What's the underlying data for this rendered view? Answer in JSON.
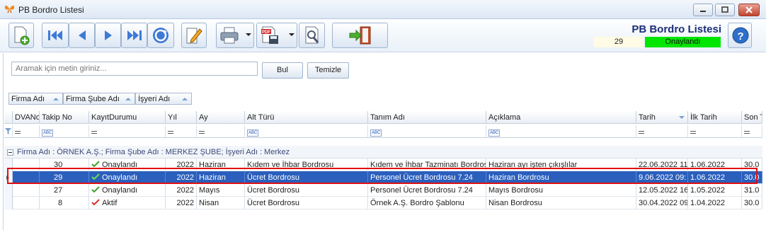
{
  "window": {
    "title": "PB Bordro Listesi"
  },
  "toolbar": {
    "buttons": [
      {
        "icon": "new-document-icon"
      },
      {
        "icon": "first-record-icon"
      },
      {
        "icon": "previous-record-icon"
      },
      {
        "icon": "next-record-icon"
      },
      {
        "icon": "last-record-icon"
      },
      {
        "icon": "refresh-icon"
      },
      {
        "icon": "edit-icon"
      },
      {
        "icon": "print-icon"
      },
      {
        "icon": "pdf-export-icon"
      },
      {
        "icon": "search-settings-icon"
      },
      {
        "icon": "exit-icon"
      }
    ]
  },
  "header": {
    "title": "PB Bordro Listesi",
    "record_no": "29",
    "status": "Onaylandı",
    "status_color": "#00e600"
  },
  "search": {
    "placeholder": "Aramak için metin giriniz...",
    "find_label": "Bul",
    "clear_label": "Temizle"
  },
  "grouping": [
    "Firma Adı",
    "Firma Şube Adı",
    "İşyeri Adı"
  ],
  "columns": [
    "DVANo",
    "Takip No",
    "KayıtDurumu",
    "Yıl",
    "Ay",
    "Alt Türü",
    "Tanım Adı",
    "Açıklama",
    "Tarih",
    "İlk Tarih",
    "Son T"
  ],
  "group_row": "Firma Adı : ÖRNEK A.Ş.;  Firma Şube Adı : MERKEZ ŞUBE;  İşyeri Adı : Merkez",
  "rows": [
    {
      "takip": "30",
      "durum": "Onaylandı",
      "yil": "2022",
      "ay": "Haziran",
      "alt": "Kıdem ve İhbar Bordrosu",
      "tanim": "Kıdem ve İhbar Tazminatı Bordros",
      "aciklama": "Haziran ayı işten çıkışlılar",
      "tarih": "22.06.2022 11",
      "ilk": "1.06.2022",
      "son": "30.0"
    },
    {
      "takip": "29",
      "durum": "Onaylandı",
      "yil": "2022",
      "ay": "Haziran",
      "alt": "Ücret Bordrosu",
      "tanim": "Personel Ücret Bordrosu 7.24",
      "aciklama": "Haziran Bordrosu",
      "tarih": "9.06.2022 09:",
      "ilk": "1.06.2022",
      "son": "30.0"
    },
    {
      "takip": "27",
      "durum": "Onaylandı",
      "yil": "2022",
      "ay": "Mayıs",
      "alt": "Ücret Bordrosu",
      "tanim": "Personel Ücret Bordrosu 7.24",
      "aciklama": "Mayıs Bordrosu",
      "tarih": "12.05.2022 16",
      "ilk": "1.05.2022",
      "son": "31.0"
    },
    {
      "takip": "8",
      "durum": "Aktif",
      "yil": "2022",
      "ay": "Nisan",
      "alt": "Ücret Bordrosu",
      "tanim": "Örnek A.Ş. Bordro Şablonu",
      "aciklama": "Nisan Bordrosu",
      "tarih": "30.04.2022 09",
      "ilk": "1.04.2022",
      "son": "30.0"
    }
  ],
  "colors": {
    "selected_row": "#2a5fbd",
    "check_ok": "#3aa52a",
    "check_active": "#d83030",
    "highlight_outline": "#e01010"
  }
}
